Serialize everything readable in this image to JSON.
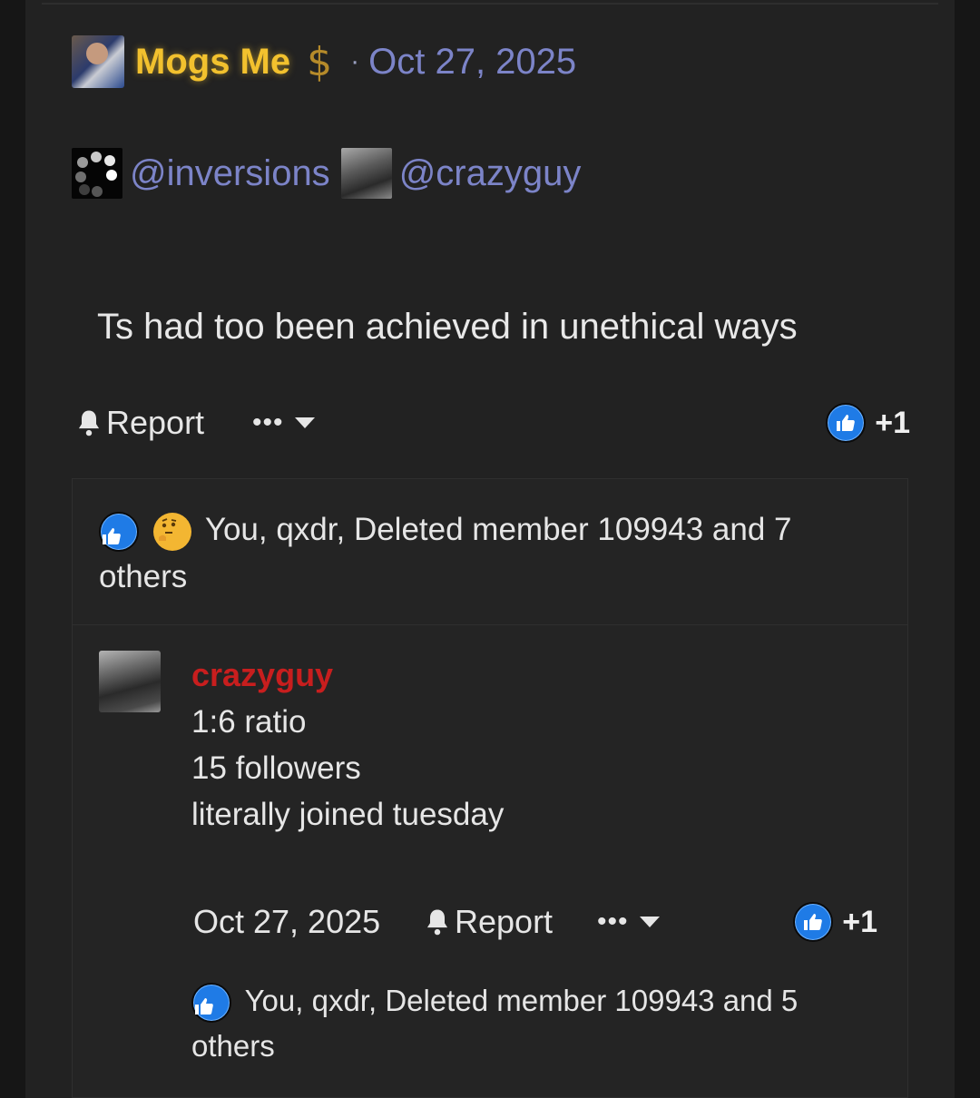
{
  "post": {
    "author": "Mogs Me",
    "author_badge": "$",
    "separator": "·",
    "date": "Oct 27, 2025",
    "mentions": [
      "@inversions",
      "@crazyguy"
    ],
    "body": "Ts had too been achieved in unethical ways",
    "report_label": "Report",
    "more_label": "•••",
    "reaction_count": "+1",
    "reaction_summary": "You, qxdr, Deleted member 109943 and 7 others"
  },
  "comment": {
    "author": "crazyguy",
    "lines": [
      "1:6 ratio",
      "15 followers",
      "literally joined tuesday"
    ],
    "date": "Oct 27, 2025",
    "report_label": "Report",
    "more_label": "•••",
    "reaction_count": "+1",
    "reaction_summary": "You, qxdr, Deleted member 109943 and 5 others"
  },
  "colors": {
    "author_gold": "#f2c12e",
    "link_blue": "#7c84c8",
    "comment_author_red": "#c81e1e",
    "like_blue": "#1f7be6",
    "background": "#222222"
  },
  "icons": [
    "bell-icon",
    "like-icon",
    "thinking-face-icon",
    "dollar-icon",
    "caret-down-icon"
  ]
}
